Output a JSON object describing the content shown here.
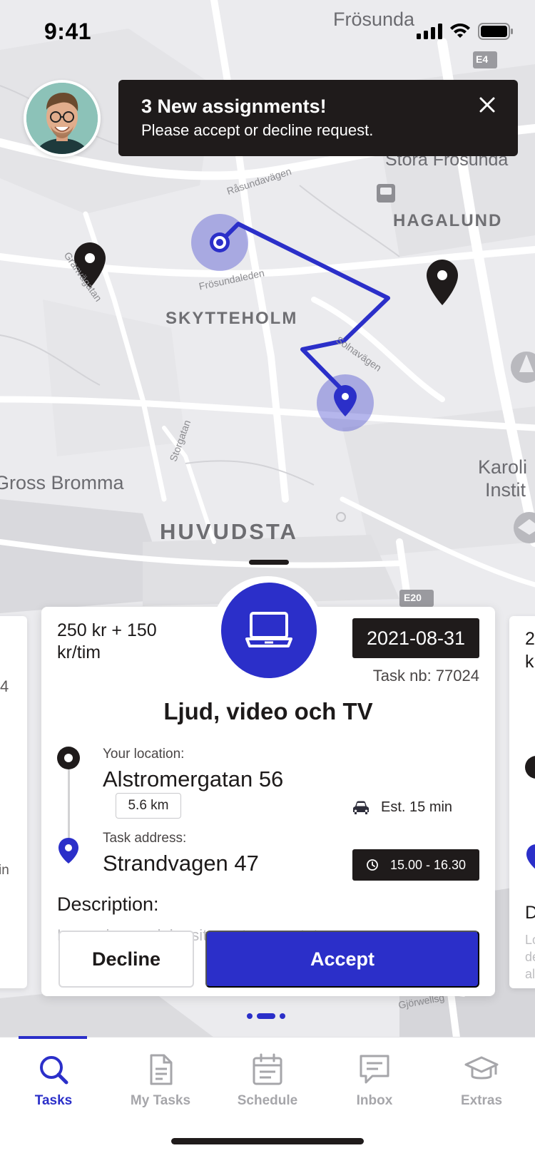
{
  "status_bar": {
    "time": "9:41"
  },
  "map": {
    "labels": {
      "frosunda": "Frösunda",
      "stora_frosunda": "Stora Frösunda",
      "hagalund": "HAGALUND",
      "skytteholm": "SKYTTEHOLM",
      "huvudsta": "HUVUDSTA",
      "bromma": "Gross Bromma",
      "karolinska_1": "Karoli",
      "karolinska_2": "Instit",
      "rasundavagen": "Råsundavägen",
      "frosundaleden": "Frösundaleden",
      "granvagatan": "Granvägatan",
      "solnavagen": "Solnavägen",
      "storgatan": "Storgatan",
      "gjorwellsg": "Gjörwellsg",
      "e4": "E4",
      "e20": "E20"
    }
  },
  "toast": {
    "title": "3 New assignments!",
    "message": "Please accept or decline request."
  },
  "task_card": {
    "price": "250 kr + 150 kr/tim",
    "date": "2021-08-31",
    "task_nb": "Task nb: 77024",
    "title": "Ljud, video och TV",
    "your_location_label": "Your location:",
    "your_location": "Alstromergatan 56",
    "distance": "5.6 km",
    "est_time": "Est. 15 min",
    "task_address_label": "Task address:",
    "task_address": "Strandvagen 47",
    "time_window": "15.00 - 16.30",
    "description_label": "Description:",
    "description_text": "Lorem ipsum dolor sit amet consectetur",
    "decline_label": "Decline",
    "accept_label": "Accept",
    "category_icon": "laptop-icon"
  },
  "side_cards": {
    "left_top": "4",
    "left_bottom": "in",
    "right_top_1": "2",
    "right_top_2": "k",
    "right_desc": "D",
    "right_text_1": "Lo",
    "right_text_2": "de",
    "right_text_3": "al"
  },
  "pager": {
    "count": 3,
    "active": 1
  },
  "tabs": [
    {
      "label": "Tasks",
      "icon": "search-icon",
      "active": true
    },
    {
      "label": "My Tasks",
      "icon": "document-icon",
      "active": false
    },
    {
      "label": "Schedule",
      "icon": "calendar-icon",
      "active": false
    },
    {
      "label": "Inbox",
      "icon": "chat-icon",
      "active": false
    },
    {
      "label": "Extras",
      "icon": "graduation-cap-icon",
      "active": false
    }
  ],
  "colors": {
    "accent": "#2b2fc9",
    "dark": "#1f1b1b",
    "map_background": "#ececef"
  }
}
